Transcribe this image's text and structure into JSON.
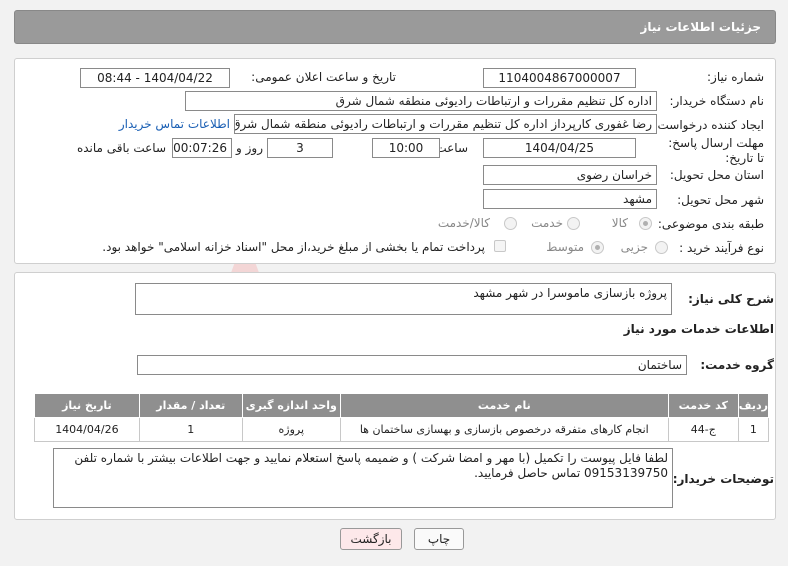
{
  "header": {
    "title": "جزئیات اطلاعات نیاز"
  },
  "form": {
    "need_number": {
      "label": "شماره نیاز:",
      "value": "1104004867000007"
    },
    "announce_datetime": {
      "label": "تاریخ و ساعت اعلان عمومی:",
      "value": "1404/04/22 - 08:44"
    },
    "buyer_org": {
      "label": "نام دستگاه خریدار:",
      "value": "اداره کل تنظیم مقررات و ارتباطات رادیوئی منطقه شمال شرق"
    },
    "requester": {
      "label": "ایجاد کننده درخواست:",
      "value": "رضا غفوری کارپرداز اداره کل تنظیم مقررات و ارتباطات رادیوئی منطقه شمال شرق",
      "contact_link": "اطلاعات تماس خریدار"
    },
    "deadline": {
      "label": "مهلت ارسال پاسخ: تا تاریخ:",
      "date": "1404/04/25",
      "time_label": "ساعت",
      "time": "10:00",
      "days": "3",
      "days_label": "روز و",
      "remaining": "00:07:26",
      "remaining_label": "ساعت باقی مانده"
    },
    "province": {
      "label": "استان محل تحویل:",
      "value": "خراسان رضوی"
    },
    "city": {
      "label": "شهر محل تحویل:",
      "value": "مشهد"
    },
    "category": {
      "label": "طبقه بندی موضوعی:",
      "options": [
        "کالا",
        "خدمت",
        "کالا/خدمت"
      ]
    },
    "process": {
      "label": "نوع فرآیند خرید :",
      "options": [
        "جزیی",
        "متوسط"
      ],
      "payment_note": "پرداخت تمام یا بخشی از مبلغ خرید،از محل \"اسناد خزانه اسلامی\" خواهد بود."
    }
  },
  "description": {
    "label": "شرح کلی نیاز:",
    "value": "پروژه بازسازی ماموسرا در شهر مشهد"
  },
  "services": {
    "title": "اطلاعات خدمات مورد نیاز",
    "group_label": "گروه خدمت:",
    "group_value": "ساختمان",
    "columns": [
      "ردیف",
      "کد خدمت",
      "نام خدمت",
      "واحد اندازه گیری",
      "تعداد / مقدار",
      "تاریخ نیاز"
    ],
    "rows": [
      [
        "1",
        "ج-44",
        "انجام کارهای متفرقه درخصوص بازسازی و بهسازی ساختمان ها",
        "پروژه",
        "1",
        "1404/04/26"
      ]
    ]
  },
  "buyer_notes": {
    "label": "توضیحات خریدار:",
    "value": "لطفا فایل پیوست را تکمیل (با مهر و امضا شرکت ) و ضمیمه پاسخ استعلام نمایید و جهت اطلاعات بیشتر با شماره تلفن 09153139750 تماس حاصل فرمایید."
  },
  "buttons": {
    "print": "چاپ",
    "back": "بازگشت"
  },
  "watermark": {
    "text": "AriaTender.neT"
  },
  "colors": {
    "header": "#9a9a9a",
    "table_header": "#8f8f8f",
    "link": "#1a5fb4",
    "back_button": "#fde8ea"
  }
}
